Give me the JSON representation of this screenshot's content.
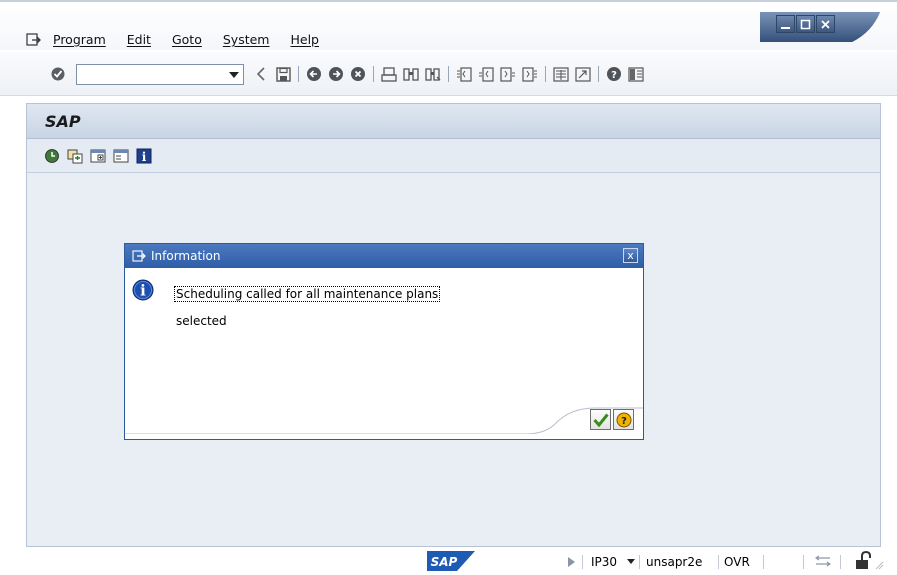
{
  "menu": {
    "items": [
      "Program",
      "Edit",
      "Goto",
      "System",
      "Help"
    ]
  },
  "toolbar": {
    "command_field_value": ""
  },
  "panel": {
    "title": "SAP"
  },
  "dialog": {
    "title": "Information",
    "message_line1": "Scheduling called for all maintenance plans",
    "message_line2": "selected",
    "close_glyph": "x"
  },
  "statusbar": {
    "logo_text": "SAP",
    "system": "IP30",
    "host": "unsapr2e",
    "mode": "OVR"
  },
  "colors": {
    "dialog_title": "#2e5ea7",
    "panel_bg": "#e8eef4",
    "window_controls": "#3c5680"
  },
  "icons": {
    "menu": "menu-window-icon",
    "toolbar": [
      "enter-check-icon",
      "back-arrow-icon",
      "save-icon",
      "back-icon",
      "exit-icon",
      "cancel-icon",
      "print-icon",
      "find-icon",
      "find-next-icon",
      "first-page-icon",
      "previous-page-icon",
      "next-page-icon",
      "last-page-icon",
      "create-session-icon",
      "shortcut-icon",
      "help-icon",
      "layout-menu-icon"
    ],
    "app_toolbar": [
      "execute-icon",
      "copy-icon",
      "new-window-icon",
      "list-icon",
      "info-icon"
    ]
  }
}
